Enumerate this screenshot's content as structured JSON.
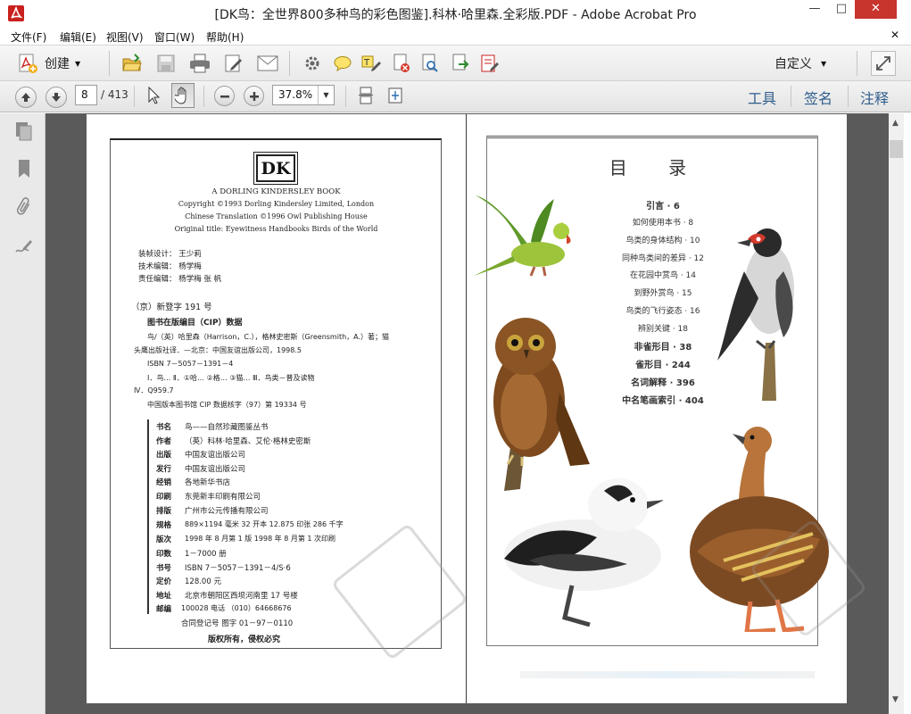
{
  "window": {
    "title": "[DK鸟：全世界800多种鸟的彩色图鉴].科林·哈里森.全彩版.PDF - Adobe Acrobat Pro"
  },
  "menu": [
    "文件(F)",
    "编辑(E)",
    "视图(V)",
    "窗口(W)",
    "帮助(H)"
  ],
  "toolbar": {
    "create_label": "创建",
    "customize_label": "自定义"
  },
  "navigation": {
    "current_page": "8",
    "page_total": "/ 413",
    "zoom": "37.8%"
  },
  "right_panels": [
    "工具",
    "签名",
    "注释"
  ],
  "left_page": {
    "logo": "DK",
    "publisher_line": "A DORLING KINDERSLEY BOOK",
    "copyright_lines": [
      "Copyright ©1993 Dorling Kindersley Limited, London",
      "Chinese Translation ©1996 Owl Publishing House",
      "Original title: Eyewitness Handbooks Birds of the World"
    ],
    "credits": [
      "装帧设计： 王少莉",
      "技术编辑： 杨学梅",
      "责任编辑： 杨学梅 张 帆"
    ],
    "registration": "（京）新登字 191 号",
    "cip_heading": "图书在版编目（CIP）数据",
    "cip_lines": [
      "鸟/（英）哈里森（Harrison，C.），格林史密斯（Greensmith，A.）著；猫",
      "头鹰出版社译．—北京：中国友谊出版公司，1998.5",
      "ISBN 7－5057－1391－4",
      "Ⅰ．鸟… Ⅱ．①哈… ②格… ③猫… Ⅲ．鸟类－普及读物",
      "Ⅳ．Q959.7",
      "中国版本图书馆 CIP 数据核字（97）第 19334 号"
    ],
    "colophon": [
      {
        "label": "书名",
        "value": "鸟——自然珍藏图鉴丛书"
      },
      {
        "label": "作者",
        "value": "（英）科林·哈里森、艾伦·格林史密斯"
      },
      {
        "label": "出版",
        "value": "中国友谊出版公司"
      },
      {
        "label": "发行",
        "value": "中国友谊出版公司"
      },
      {
        "label": "经销",
        "value": "各地新华书店"
      },
      {
        "label": "印刷",
        "value": "东莞新丰印刷有限公司"
      },
      {
        "label": "排版",
        "value": "广州市公元传播有限公司"
      },
      {
        "label": "规格",
        "value": "889×1194 毫米 32 开本 12.875 印张 286 千字"
      },
      {
        "label": "版次",
        "value": "1998 年 8 月第 1 版 1998 年 8 月第 1 次印刷"
      },
      {
        "label": "印数",
        "value": "1－7000 册"
      },
      {
        "label": "书号",
        "value": "ISBN 7－5057－1391－4/S·6"
      },
      {
        "label": "定价",
        "value": "128.00 元"
      },
      {
        "label": "地址",
        "value": "北京市朝阳区西坝河南里 17 号楼"
      },
      {
        "label": "邮编",
        "value": "100028 电话 （010）64668676"
      }
    ],
    "contract_reg": "合同登记号 图字 01－97－0110",
    "rights": "版权所有，侵权必究"
  },
  "right_page": {
    "toc_title": "目 录",
    "toc": [
      {
        "text": "引言 · 6",
        "bold": true
      },
      {
        "text": "如何使用本书 · 8",
        "bold": false
      },
      {
        "text": "鸟类的身体结构 · 10",
        "bold": false
      },
      {
        "text": "同种鸟类间的差异 · 12",
        "bold": false
      },
      {
        "text": "在花园中赏鸟 · 14",
        "bold": false
      },
      {
        "text": "到野外赏鸟 · 15",
        "bold": false
      },
      {
        "text": "鸟类的飞行姿态 · 16",
        "bold": false
      },
      {
        "text": "辨别关键 · 18",
        "bold": false
      },
      {
        "text": "非雀形目 · 38",
        "bold": true
      },
      {
        "text": "雀形目 · 244",
        "bold": true
      },
      {
        "text": "名词解释 · 396",
        "bold": true
      },
      {
        "text": "中名笔画索引 · 404",
        "bold": true
      }
    ]
  }
}
